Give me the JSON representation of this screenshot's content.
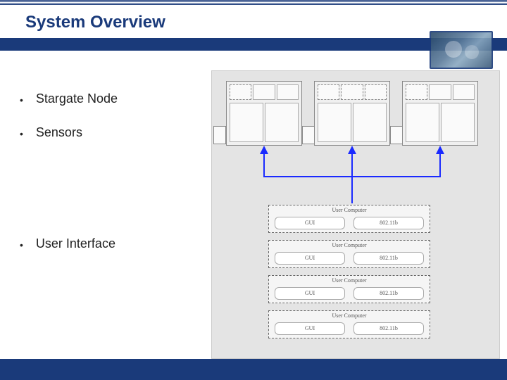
{
  "slide": {
    "title": "System Overview",
    "bullets": [
      "Stargate Node",
      "Sensors",
      "User Interface"
    ]
  },
  "diagram": {
    "user_computer_label": "User Computer",
    "gui_label": "GUI",
    "wifi_label": "802.11b",
    "node_count": 3,
    "user_computer_count": 4
  },
  "colors": {
    "brand": "#1a3a7a",
    "diagram_bg": "#e4e4e4",
    "connector": "#1a2aff"
  }
}
